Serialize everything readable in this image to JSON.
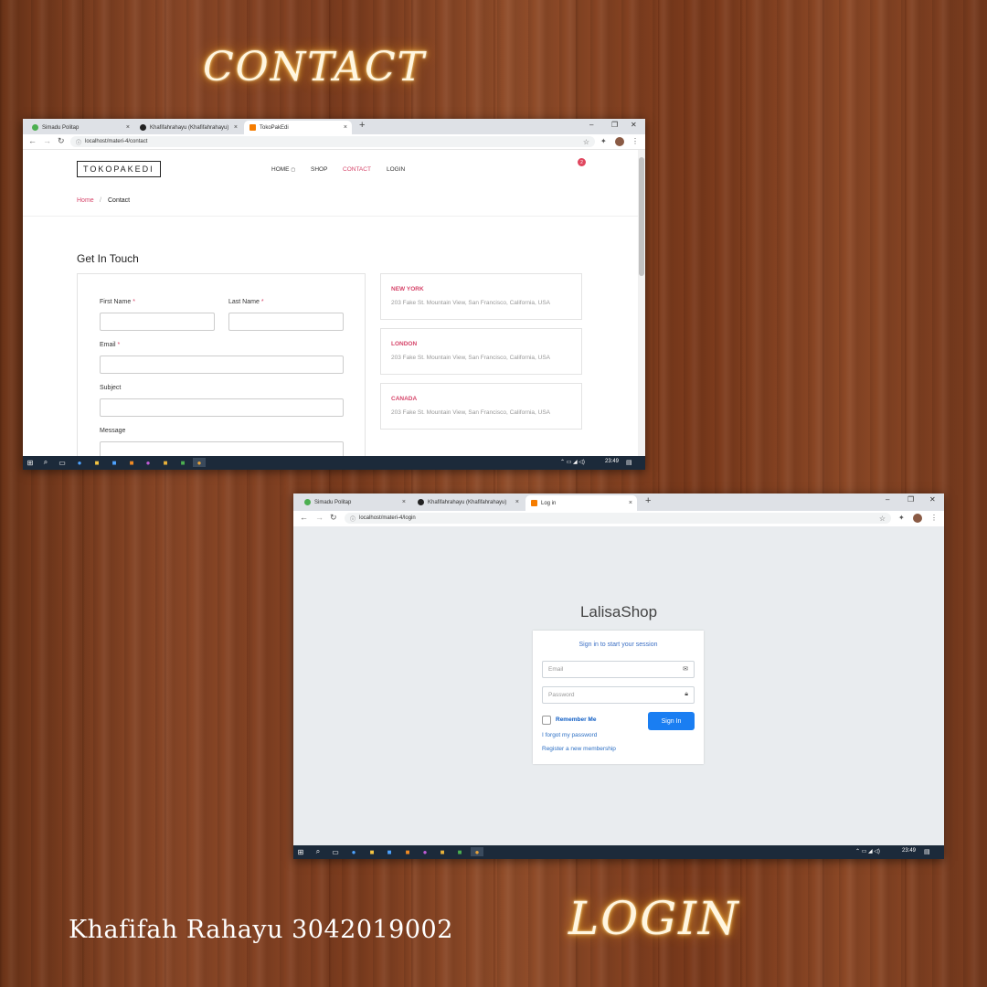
{
  "decor": {
    "contact_title": "CONTACT",
    "login_title": "LOGIN",
    "author": "Khafifah Rahayu  3042019002"
  },
  "browser1": {
    "tabs": [
      {
        "title": "Simadu Politap",
        "close": "×",
        "favicon_color": "#4caf50"
      },
      {
        "title": "Khafifahrahayu (Khafifahrahayu)",
        "close": "×",
        "favicon_color": "#222222"
      },
      {
        "title": "TokoPakEdi",
        "close": "×",
        "favicon_color": "#f57c00"
      }
    ],
    "new_tab": "+",
    "url": "localhost/materi-4/contact"
  },
  "contact_page": {
    "logo": "TOKOPAKEDI",
    "menu": [
      {
        "label": "HOME",
        "active": false
      },
      {
        "label": "SHOP",
        "active": false
      },
      {
        "label": "CONTACT",
        "active": true
      },
      {
        "label": "LOGIN",
        "active": false
      }
    ],
    "cart_count": "2",
    "breadcrumb": {
      "home": "Home",
      "separator": "/",
      "current": "Contact"
    },
    "heading": "Get In Touch",
    "form": {
      "first_name": "First Name",
      "last_name": "Last Name",
      "email": "Email",
      "subject": "Subject",
      "message": "Message",
      "required_mark": "*"
    },
    "locations": [
      {
        "city": "NEW YORK",
        "address": "203 Fake St. Mountain View, San Francisco, California, USA"
      },
      {
        "city": "LONDON",
        "address": "203 Fake St. Mountain View, San Francisco, California, USA"
      },
      {
        "city": "CANADA",
        "address": "203 Fake St. Mountain View, San Francisco, California, USA"
      }
    ]
  },
  "taskbar1": {
    "time": "23:49"
  },
  "browser2": {
    "tabs": [
      {
        "title": "Simadu Politap",
        "close": "×",
        "favicon_color": "#4caf50"
      },
      {
        "title": "Khafifahrahayu (Khafifahrahayu)",
        "close": "×",
        "favicon_color": "#222222"
      },
      {
        "title": "Log in",
        "close": "×",
        "favicon_color": "#f57c00"
      }
    ],
    "new_tab": "+",
    "url": "localhost/materi-4/login"
  },
  "login_page": {
    "brand": "LalisaShop",
    "message": "Sign in to start your session",
    "email_placeholder": "Email",
    "password_placeholder": "Password",
    "remember": "Remember Me",
    "sign_in": "Sign In",
    "forgot": "I forgot my password",
    "register": "Register a new membership"
  },
  "taskbar2": {
    "time": "23:49"
  }
}
